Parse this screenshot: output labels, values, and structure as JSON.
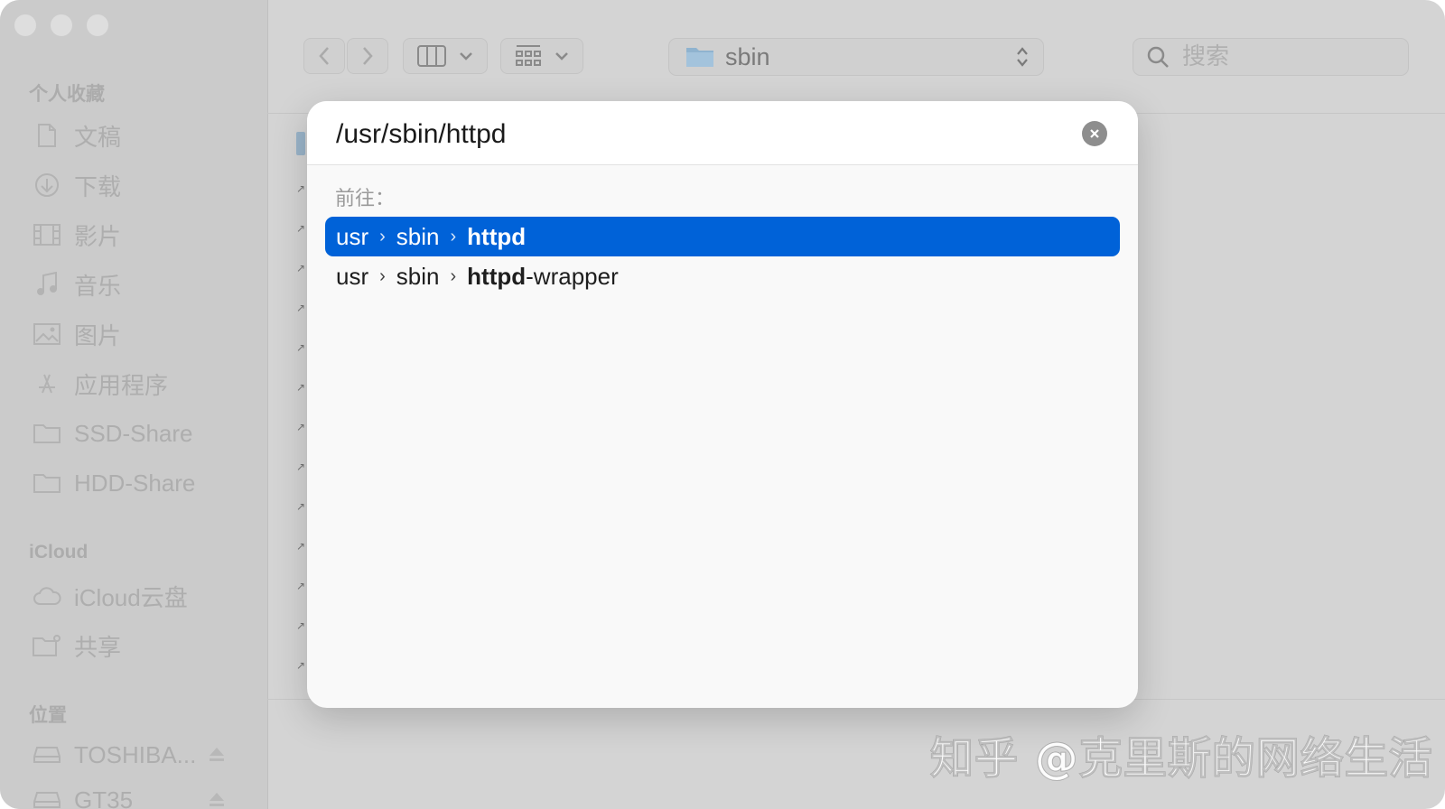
{
  "sidebar": {
    "favorites_title": "个人收藏",
    "favorites": [
      {
        "label": "文稿",
        "icon": "document-icon"
      },
      {
        "label": "下载",
        "icon": "download-icon"
      },
      {
        "label": "影片",
        "icon": "film-icon"
      },
      {
        "label": "音乐",
        "icon": "music-icon"
      },
      {
        "label": "图片",
        "icon": "photo-icon"
      },
      {
        "label": "应用程序",
        "icon": "applications-icon"
      },
      {
        "label": "SSD-Share",
        "icon": "folder-icon"
      },
      {
        "label": "HDD-Share",
        "icon": "folder-icon"
      }
    ],
    "icloud_title": "iCloud",
    "icloud": [
      {
        "label": "iCloud云盘",
        "icon": "cloud-icon"
      },
      {
        "label": "共享",
        "icon": "shared-folder-icon"
      }
    ],
    "locations_title": "位置",
    "locations": [
      {
        "label": "TOSHIBA...",
        "icon": "drive-icon"
      },
      {
        "label": "GT35",
        "icon": "drive-icon"
      }
    ]
  },
  "toolbar": {
    "current_folder": "sbin",
    "search_placeholder": "搜索"
  },
  "goto_dialog": {
    "input_value": "/usr/sbin/httpd",
    "section_label": "前往：",
    "results": [
      {
        "segments": [
          "usr",
          "sbin"
        ],
        "match": "httpd",
        "suffix": "",
        "selected": true
      },
      {
        "segments": [
          "usr",
          "sbin"
        ],
        "match": "httpd",
        "suffix": "-wrapper",
        "selected": false
      }
    ]
  },
  "watermark": "知乎 @克里斯的网络生活",
  "colors": {
    "selection": "#0062d8",
    "dim_overlay": "#d4d4d4",
    "dialog_bg": "#f9f9f9"
  }
}
